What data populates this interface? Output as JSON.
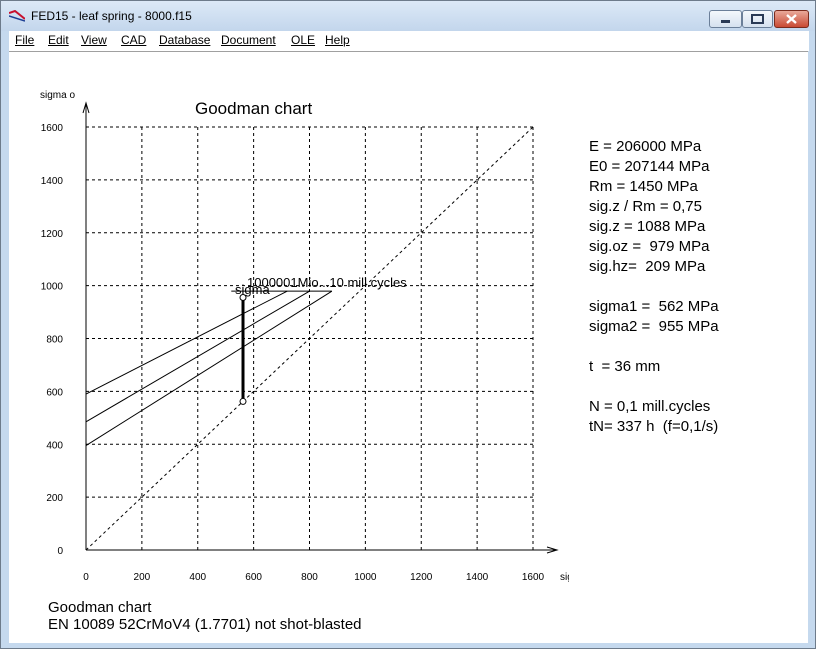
{
  "window": {
    "title": "FED15 - leaf spring  - 8000.f15",
    "minimize_label": "minimize",
    "maximize_label": "maximize",
    "close_label": "close"
  },
  "menu": {
    "items": [
      {
        "label": "File"
      },
      {
        "label": "Edit"
      },
      {
        "label": "View"
      },
      {
        "label": "CAD"
      },
      {
        "label": "Database"
      },
      {
        "label": "Document"
      },
      {
        "label": "OLE"
      },
      {
        "label": "Help"
      }
    ]
  },
  "info": {
    "lines": [
      "E = 206000 MPa",
      "E0 = 207144 MPa",
      "Rm = 1450 MPa",
      "sig.z / Rm = 0,75",
      "sig.z = 1088 MPa",
      "sig.oz =  979 MPa",
      "sig.hz=  209 MPa",
      "",
      "sigma1 =  562 MPa",
      "sigma2 =  955 MPa",
      "",
      "t  = 36 mm",
      "",
      "N = 0,1 mill.cycles",
      "tN= 337 h  (f=0,1/s)"
    ]
  },
  "footer": {
    "line1": "Goodman chart",
    "line2": "EN 10089 52CrMoV4 (1.7701) not shot-blasted"
  },
  "chart_data": {
    "type": "line",
    "title": "Goodman chart",
    "xlabel": "sigma u [MPa]",
    "ylabel": "sigma o",
    "xlim": [
      0,
      1600
    ],
    "ylim": [
      0,
      1600
    ],
    "x_ticks": [
      0,
      200,
      400,
      600,
      800,
      1000,
      1200,
      1400,
      1600
    ],
    "y_ticks": [
      0,
      200,
      400,
      600,
      800,
      1000,
      1200,
      1400,
      1600
    ],
    "grid": true,
    "series": [
      {
        "values": [
          [
            0,
            590
          ],
          [
            720,
            979
          ]
        ]
      },
      {
        "values": [
          [
            0,
            485
          ],
          [
            800,
            979
          ]
        ]
      },
      {
        "values": [
          [
            0,
            395
          ],
          [
            880,
            979
          ]
        ]
      },
      {
        "values": [
          [
            0,
            0
          ],
          [
            1600,
            1600
          ]
        ],
        "style": "dashed"
      }
    ],
    "cap_line": {
      "y": 979,
      "x_from": 520,
      "x_to": 880
    },
    "spring_range": {
      "sigma_u": 562,
      "sigma_lower": 562,
      "sigma_upper": 955
    },
    "annotations": [
      "1000001Mio...10 mill.cycles",
      "sigma"
    ]
  }
}
